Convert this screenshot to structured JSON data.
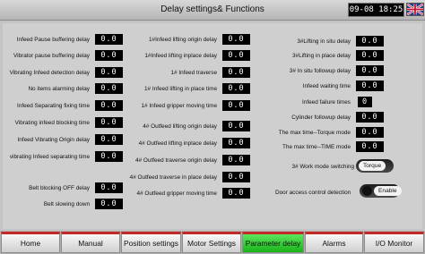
{
  "header": {
    "title": "Delay settings& Functions",
    "datetime": "09-08 18:25",
    "language_icon": "uk-flag-icon"
  },
  "col1": [
    {
      "label": "Infeed Pause buffering delay",
      "value": "0.0"
    },
    {
      "label": "Vibrator pause buffering delay",
      "value": "0.0"
    },
    {
      "label": "Vibrating Infeed detection delay",
      "value": "0.0"
    },
    {
      "label": "No items alarming delay",
      "value": "0.0"
    },
    {
      "label": "Infeed Separating fixing time",
      "value": "0.0"
    },
    {
      "label": "Vibrating infeed blocking time",
      "value": "0.0"
    },
    {
      "label": "Infeed Vibrating  Origin delay",
      "value": "0.0"
    },
    {
      "label": "vibrating Infeed separating time",
      "value": "0.0"
    },
    {
      "label": "Belt blocking OFF delay",
      "value": "0.0"
    },
    {
      "label": "Belt slowing down",
      "value": "0.0"
    }
  ],
  "col2": [
    {
      "label": "1#Infeed lifting origin delay",
      "value": "0.0"
    },
    {
      "label": "1#Infeed lifting inplace delay",
      "value": "0.0"
    },
    {
      "label": "1# Infeed traverse",
      "value": "0.0"
    },
    {
      "label": "1# Infeed lifting in place time",
      "value": "0.0"
    },
    {
      "label": "1# Infeed gripper moving time",
      "value": "0.0"
    },
    {
      "label": "4# Outfeed lifting origin delay",
      "value": "0.0"
    },
    {
      "label": "4# Outfeed lifting inplace delay",
      "value": "0.0"
    },
    {
      "label": "4# Outfeed traverse origin delay",
      "value": "0.0"
    },
    {
      "label": "4# Outfeed traverse in place delay",
      "value": "0.0"
    },
    {
      "label": "4# Outfeed gripper moving time",
      "value": "0.0"
    }
  ],
  "col3": [
    {
      "label": "3#Lifting in situ delay",
      "value": "0.0"
    },
    {
      "label": "3#Lifting in place delay",
      "value": "0.0"
    },
    {
      "label": "3#  In situ followup delay",
      "value": "0.0"
    },
    {
      "label": "Infeed waiting time",
      "value": "0.0"
    },
    {
      "label": "Infeed failure times",
      "value": "0"
    },
    {
      "label": "Cylinder followup delay",
      "value": "0.0"
    },
    {
      "label": "The max time--Torque  mode",
      "value": "0.0"
    },
    {
      "label": "The max time--TIME  mode",
      "value": "0.0"
    }
  ],
  "switches": [
    {
      "label": "3# Work mode switching",
      "state": "Torque"
    },
    {
      "label": "Door access control detection",
      "state": "Enable"
    }
  ],
  "nav": [
    {
      "label": "Home",
      "active": false
    },
    {
      "label": "Manual",
      "active": false
    },
    {
      "label": "Position settings",
      "active": false
    },
    {
      "label": "Motor Settings",
      "active": false
    },
    {
      "label": "Parameter delay",
      "active": true
    },
    {
      "label": "Alarms",
      "active": false
    },
    {
      "label": "I/O Monitor",
      "active": false
    }
  ]
}
